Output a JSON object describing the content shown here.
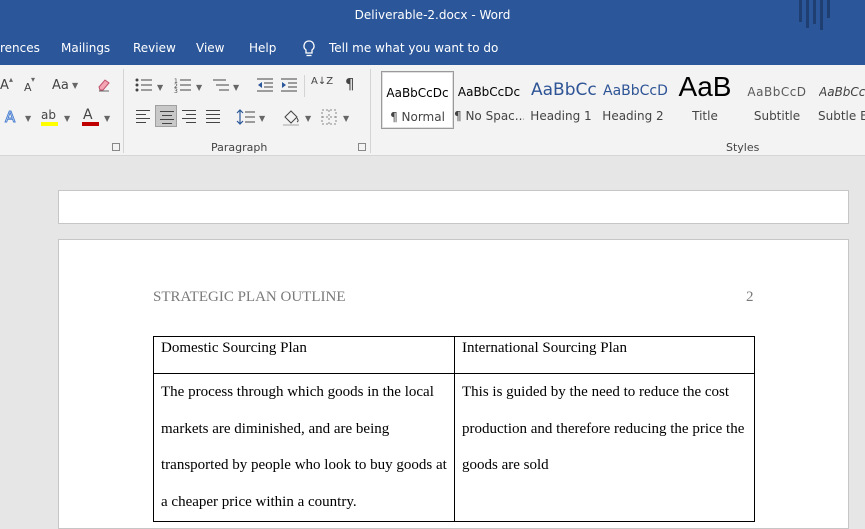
{
  "window": {
    "title": "Deliverable-2.docx  -  Word"
  },
  "menu": {
    "items": [
      "rences",
      "Mailings",
      "Review",
      "View",
      "Help"
    ],
    "tell_me": "Tell me what you want to do"
  },
  "ribbon": {
    "font_group": {
      "case_label": "Aa",
      "grow_label": "A",
      "shrink_label": "A",
      "highlight_label": "ab",
      "font_color_label": "A"
    },
    "paragraph": {
      "label": "Paragraph",
      "sort_label": "A↓Z",
      "pilcrow": "¶",
      "selected_alignment": "center"
    },
    "styles": {
      "label": "Styles",
      "items": [
        {
          "sample": "AaBbCcDc",
          "name": "¶ Normal",
          "selected": true
        },
        {
          "sample": "AaBbCcDc",
          "name": "¶ No Spac..."
        },
        {
          "sample": "AaBbCc",
          "name": "Heading 1"
        },
        {
          "sample": "AaBbCcD",
          "name": "Heading 2"
        },
        {
          "sample": "AaB",
          "name": "Title"
        },
        {
          "sample": "AaBbCcD",
          "name": "Subtitle"
        },
        {
          "sample": "AaBbCcDc",
          "name": "Subtle Em"
        }
      ]
    }
  },
  "document": {
    "header_title": "STRATEGIC PLAN OUTLINE",
    "page_number": "2",
    "table": {
      "headers": [
        "Domestic Sourcing Plan",
        "International Sourcing Plan"
      ],
      "row": [
        "The process through which goods in the local markets are diminished, and are being transported by people who look to buy goods at a cheaper price within a country.",
        "This is guided by the need to reduce the cost production and therefore reducing the price the goods are sold"
      ]
    }
  },
  "colors": {
    "titlebar": "#2b579a",
    "heading_blue": "#2f5496",
    "font_red": "#c00000",
    "highlight_yellow": "#ffff00"
  }
}
